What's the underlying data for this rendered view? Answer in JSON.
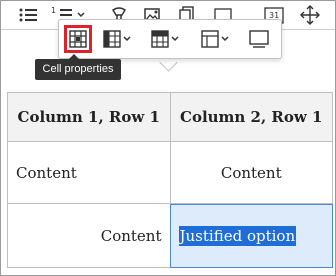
{
  "toolbar": {
    "heading_badge": "1",
    "calendar_badge": "31"
  },
  "balloon": {
    "cell_properties_tooltip": "Cell properties"
  },
  "table": {
    "header": [
      "Column 1, Row 1",
      "Column 2, Row 1"
    ],
    "row2": [
      "Content",
      "Content"
    ],
    "row3": [
      "Content",
      "Justified option"
    ]
  },
  "colors": {
    "highlight": "#e0202a",
    "selection": "#1f6ed8",
    "tooltip_bg": "#333333"
  }
}
